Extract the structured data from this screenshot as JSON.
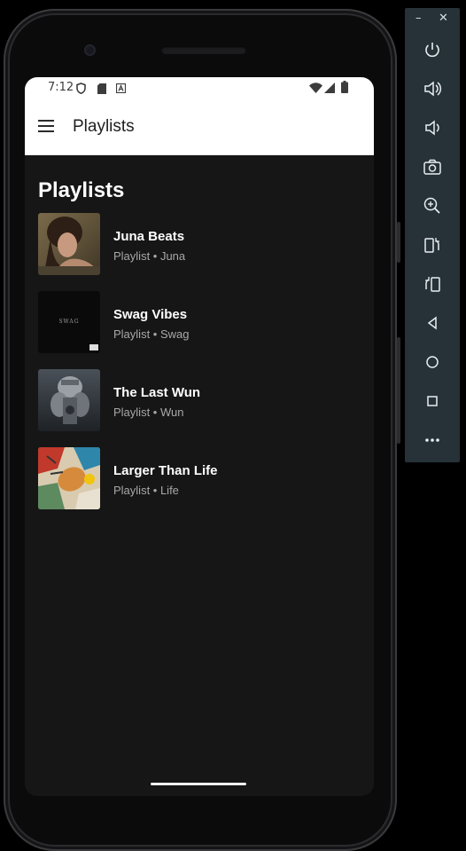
{
  "status_bar": {
    "time": "7:12",
    "icons": [
      "shield-icon",
      "sd-card-icon",
      "notification-a-icon",
      "wifi-icon",
      "cellular-signal-icon",
      "battery-icon"
    ]
  },
  "app_bar": {
    "menu_icon": "hamburger-menu-icon",
    "title": "Playlists"
  },
  "main": {
    "heading": "Playlists",
    "playlists": [
      {
        "title": "Juna Beats",
        "subtitle": "Playlist • Juna",
        "cover": "portrait-photo-cover"
      },
      {
        "title": "Swag Vibes",
        "subtitle": "Playlist • Swag",
        "cover": "black-swag-cover",
        "cover_text": "SWAG"
      },
      {
        "title": "The Last Wun",
        "subtitle": "Playlist • Wun",
        "cover": "dark-figure-cover"
      },
      {
        "title": "Larger Than Life",
        "subtitle": "Playlist • Life",
        "cover": "colorful-collage-cover"
      }
    ]
  },
  "emulator_toolbar": {
    "window_controls": {
      "minimize": "–",
      "close": "✕"
    },
    "buttons": [
      "power-icon",
      "volume-up-icon",
      "volume-down-icon",
      "screenshot-camera-icon",
      "zoom-icon",
      "rotate-left-icon",
      "rotate-right-icon",
      "back-icon",
      "home-icon",
      "overview-icon",
      "more-icon"
    ]
  },
  "colors": {
    "screen_background": "#161616",
    "app_bar_background": "#ffffff",
    "toolbar_background": "#263238",
    "subtitle_text": "#a8a8a8"
  }
}
